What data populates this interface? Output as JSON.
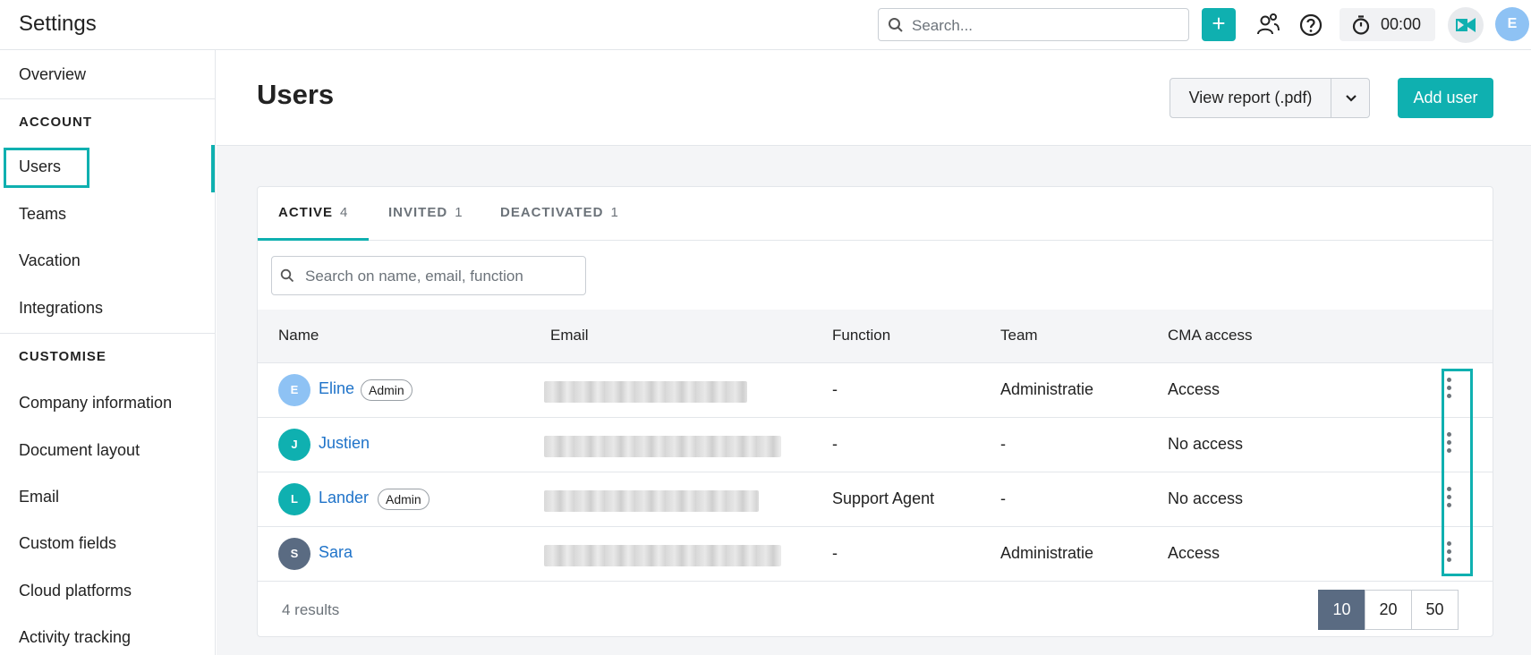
{
  "app": {
    "title": "Settings"
  },
  "topbar": {
    "search_placeholder": "Search...",
    "add_label": "+",
    "timer": "00:00",
    "avatar_initial": "E"
  },
  "sidebar": {
    "overview": "Overview",
    "account_header": "ACCOUNT",
    "account_items": [
      "Users",
      "Teams",
      "Vacation",
      "Integrations"
    ],
    "customise_header": "CUSTOMISE",
    "customise_items": [
      "Company information",
      "Document layout",
      "Email",
      "Custom fields",
      "Cloud platforms",
      "Activity tracking"
    ]
  },
  "header": {
    "title": "Users",
    "view_report_label": "View report (.pdf)",
    "add_user_label": "Add user"
  },
  "tabs": [
    {
      "label": "ACTIVE",
      "count": "4"
    },
    {
      "label": "INVITED",
      "count": "1"
    },
    {
      "label": "DEACTIVATED",
      "count": "1"
    }
  ],
  "table": {
    "search_placeholder": "Search on name, email, function",
    "columns": [
      "Name",
      "Email",
      "Function",
      "Team",
      "CMA access"
    ],
    "rows": [
      {
        "initial": "E",
        "name": "Eline",
        "badge": "Admin",
        "function": "-",
        "team": "Administratie",
        "access": "Access",
        "avatar_color": "#8ec2f4"
      },
      {
        "initial": "J",
        "name": "Justien",
        "badge": "",
        "function": "-",
        "team": "-",
        "access": "No access",
        "avatar_color": "#0fb0b0"
      },
      {
        "initial": "L",
        "name": "Lander",
        "badge": "Admin",
        "function": "Support Agent",
        "team": "-",
        "access": "No access",
        "avatar_color": "#0fb0b0"
      },
      {
        "initial": "S",
        "name": "Sara",
        "badge": "",
        "function": "-",
        "team": "Administratie",
        "access": "Access",
        "avatar_color": "#5a6b82"
      }
    ],
    "results": "4 results",
    "page_sizes": [
      "10",
      "20",
      "50"
    ],
    "selected_page_size": "10"
  },
  "colors": {
    "accent": "#0fb0b0",
    "link": "#1f73c9"
  }
}
